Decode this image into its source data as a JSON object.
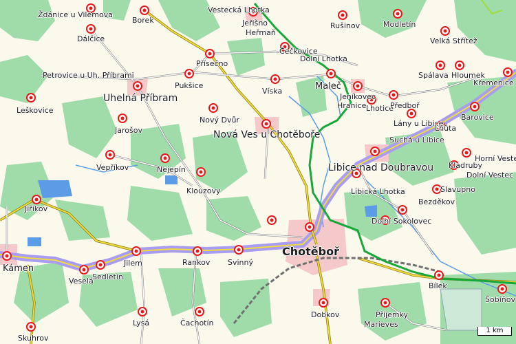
{
  "map": {
    "scale_label": "1 km",
    "colors": {
      "background": "#fbf8ec",
      "forest": "#9fdcaa",
      "urban": "#f5c9c9",
      "water": "#5c9ce6",
      "highway": "#a89cf4",
      "road_major": "#f0dc3c",
      "road_minor": "#ffffff",
      "rail": "#707070",
      "border": "#18a83a",
      "marker": "#e81818"
    },
    "places": [
      {
        "id": "zdanice",
        "name": "Ždánice u Vilémova",
        "size": "sm"
      },
      {
        "id": "dalcice",
        "name": "Dálčice",
        "size": "sm"
      },
      {
        "id": "borek",
        "name": "Borek",
        "size": "sm"
      },
      {
        "id": "vestecka",
        "name": "Vestecká Lhotka",
        "size": "sm"
      },
      {
        "id": "jersino",
        "name": "Jeřišno",
        "size": "sm"
      },
      {
        "id": "herman",
        "name": "Heřmaň",
        "size": "sm"
      },
      {
        "id": "rusinov",
        "name": "Rušinov",
        "size": "sm"
      },
      {
        "id": "modletin",
        "name": "Modletín",
        "size": "sm"
      },
      {
        "id": "velkastr",
        "name": "Velká Střítež",
        "size": "sm"
      },
      {
        "id": "ceckovice",
        "name": "Čečkovice",
        "size": "sm"
      },
      {
        "id": "dolnilhotka",
        "name": "Dolní Lhotka",
        "size": "sm"
      },
      {
        "id": "prisecno",
        "name": "Přísečno",
        "size": "sm"
      },
      {
        "id": "petrovice",
        "name": "Petrovice u Uh. Příbrami",
        "size": "sm"
      },
      {
        "id": "puksice",
        "name": "Pukšice",
        "size": "sm"
      },
      {
        "id": "viska",
        "name": "Víska",
        "size": "sm"
      },
      {
        "id": "malec",
        "name": "Maleč",
        "size": "md"
      },
      {
        "id": "spalava",
        "name": "Spálava",
        "size": "sm"
      },
      {
        "id": "hloumek",
        "name": "Hloumek",
        "size": "sm"
      },
      {
        "id": "kremenice",
        "name": "Křemenice",
        "size": "sm"
      },
      {
        "id": "leskovice",
        "name": "Leškovice",
        "size": "sm"
      },
      {
        "id": "uhelna",
        "name": "Uhelná Příbram",
        "size": "lg"
      },
      {
        "id": "jeniko",
        "name": "Jeníkovec",
        "size": "sm"
      },
      {
        "id": "hranice",
        "name": "Hranice",
        "size": "sm"
      },
      {
        "id": "lhotice",
        "name": "Lhotice",
        "size": "sm"
      },
      {
        "id": "predbor",
        "name": "Předboř",
        "size": "sm"
      },
      {
        "id": "barovice",
        "name": "Barovice",
        "size": "sm"
      },
      {
        "id": "novydvur",
        "name": "Nový Dvůr",
        "size": "sm"
      },
      {
        "id": "jarosov",
        "name": "Jarošov",
        "size": "sm"
      },
      {
        "id": "novaves",
        "name": "Nová Ves u Chotěboře",
        "size": "lg"
      },
      {
        "id": "lany",
        "name": "Lány u Libice",
        "size": "sm"
      },
      {
        "id": "lhuta",
        "name": "Lhůta",
        "size": "sm"
      },
      {
        "id": "sucha",
        "name": "Suchá u Libice",
        "size": "sm"
      },
      {
        "id": "hornivestec",
        "name": "Horní Vestec",
        "size": "sm"
      },
      {
        "id": "veprikov",
        "name": "Vepříkov",
        "size": "sm"
      },
      {
        "id": "nejepin",
        "name": "Nejepín",
        "size": "sm"
      },
      {
        "id": "libice",
        "name": "Libice nad Doubravou",
        "size": "lg"
      },
      {
        "id": "kladruby",
        "name": "Kladruby",
        "size": "sm"
      },
      {
        "id": "dolnivestec",
        "name": "Dolní Vestec",
        "size": "sm"
      },
      {
        "id": "libickalh",
        "name": "Libická Lhotka",
        "size": "sm"
      },
      {
        "id": "slavupno",
        "name": "Slavupno",
        "size": "sm"
      },
      {
        "id": "klouzovy",
        "name": "Klouzovy",
        "size": "sm"
      },
      {
        "id": "bezdekov",
        "name": "Bezděkov",
        "size": "sm"
      },
      {
        "id": "jirikov",
        "name": "Jiříkov",
        "size": "sm"
      },
      {
        "id": "dolnisok",
        "name": "Dolní Sokolovec",
        "size": "sm"
      },
      {
        "id": "chotebor",
        "name": "Chotěboř",
        "size": "xl"
      },
      {
        "id": "kamen",
        "name": "Kámen",
        "size": "md"
      },
      {
        "id": "rankov",
        "name": "Rankov",
        "size": "sm"
      },
      {
        "id": "svinny",
        "name": "Svinný",
        "size": "sm"
      },
      {
        "id": "jilem",
        "name": "Jilem",
        "size": "sm"
      },
      {
        "id": "sedletin",
        "name": "Sedletín",
        "size": "sm"
      },
      {
        "id": "vesela",
        "name": "Veselá",
        "size": "sm"
      },
      {
        "id": "bilek",
        "name": "Bílek",
        "size": "sm"
      },
      {
        "id": "sobinov",
        "name": "Sobíňov",
        "size": "sm"
      },
      {
        "id": "prijemky",
        "name": "Příjemky",
        "size": "sm"
      },
      {
        "id": "marieves",
        "name": "Marieves",
        "size": "sm"
      },
      {
        "id": "dobkov",
        "name": "Dobkov",
        "size": "sm"
      },
      {
        "id": "lysa",
        "name": "Lysá",
        "size": "sm"
      },
      {
        "id": "cachotin",
        "name": "Čachotín",
        "size": "sm"
      },
      {
        "id": "skuhrov",
        "name": "Skuhrov",
        "size": "sm"
      }
    ]
  }
}
